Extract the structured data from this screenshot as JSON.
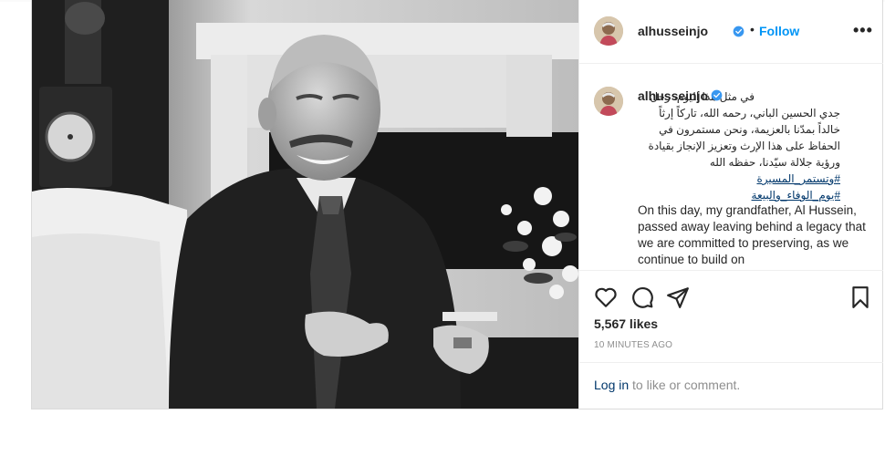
{
  "post": {
    "username": "alhusseinjo",
    "follow_separator": "•",
    "follow_label": "Follow",
    "more_label": "•••",
    "caption": {
      "username": "alhusseinjo",
      "arabic_text": "في مثل هذا اليوم، رحل جدي الحسين الباني، رحمه الله، تاركاً إرثاً خالداً بمدّنا بالعزيمة، ونحن مستمرون في الحفاظ على هذا الإرث وتعزيز الإنجاز بقيادة ورؤية جلالة سيّدنا، حفظه الله",
      "hashtags": [
        "#وتستمر_المسيرة",
        "#يوم_الوفاء_والبيعة"
      ],
      "english_text": "On this day, my grandfather, Al Hussein, passed away leaving behind a legacy that we are committed to preserving, as we continue to build on"
    },
    "likes": "5,567 likes",
    "time_ago": "10 MINUTES AGO",
    "login_link": "Log in",
    "login_rest": " to like or comment."
  },
  "icons": {
    "heart": "heart-icon",
    "comment": "comment-icon",
    "share": "share-icon",
    "save": "bookmark-icon",
    "verified": "verified-badge-icon"
  },
  "colors": {
    "accent": "#0095f6",
    "link": "#00376b",
    "text": "#262626",
    "muted": "#8e8e8e",
    "border": "#dbdbdb",
    "verified": "#3897f0"
  }
}
